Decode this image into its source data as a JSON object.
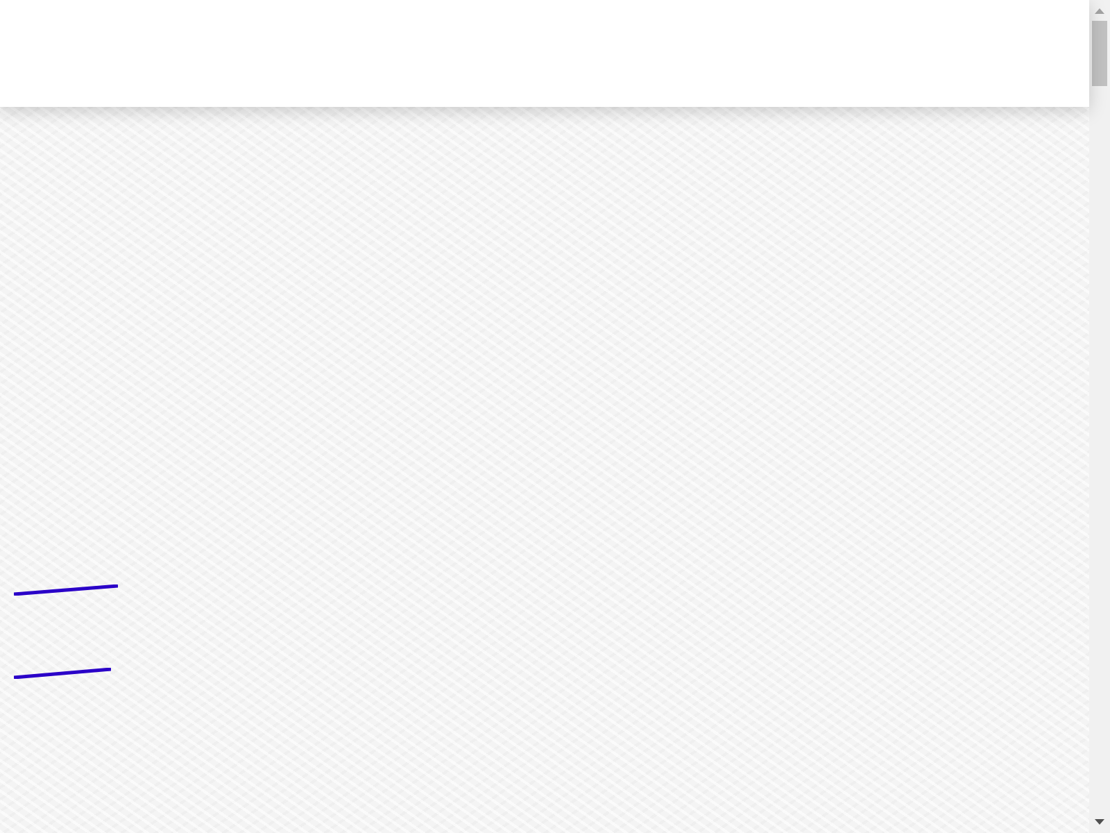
{
  "strokes": [
    {
      "kind": "underline"
    },
    {
      "kind": "underline"
    }
  ]
}
